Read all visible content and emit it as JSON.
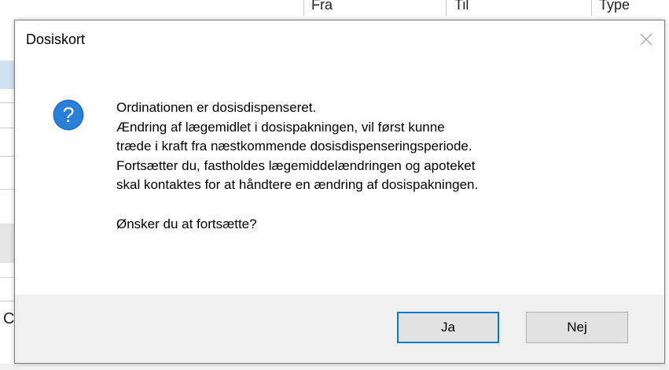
{
  "background": {
    "columns": [
      "Fra",
      "Til",
      "Type"
    ],
    "left_fragment": "C"
  },
  "dialog": {
    "title": "Dosiskort",
    "close_icon": "close-icon",
    "icon": "question-icon",
    "message_lines": [
      "Ordinationen er dosisdispenseret.",
      "Ændring af lægemidlet i dosispakningen, vil først kunne",
      "træde i kraft fra næstkommende dosisdispenseringsperiode.",
      "Fortsætter du, fastholdes lægemiddelændringen og apoteket",
      "skal kontaktes for at håndtere en ændring af dosispakningen."
    ],
    "question": "Ønsker du at fortsætte?",
    "buttons": {
      "yes_label": "Ja",
      "no_label": "Nej"
    }
  },
  "colors": {
    "accent": "#0078d7",
    "icon_blue": "#1e6fc5",
    "footer_bg": "#f0f0f0",
    "button_bg": "#e1e1e1"
  }
}
